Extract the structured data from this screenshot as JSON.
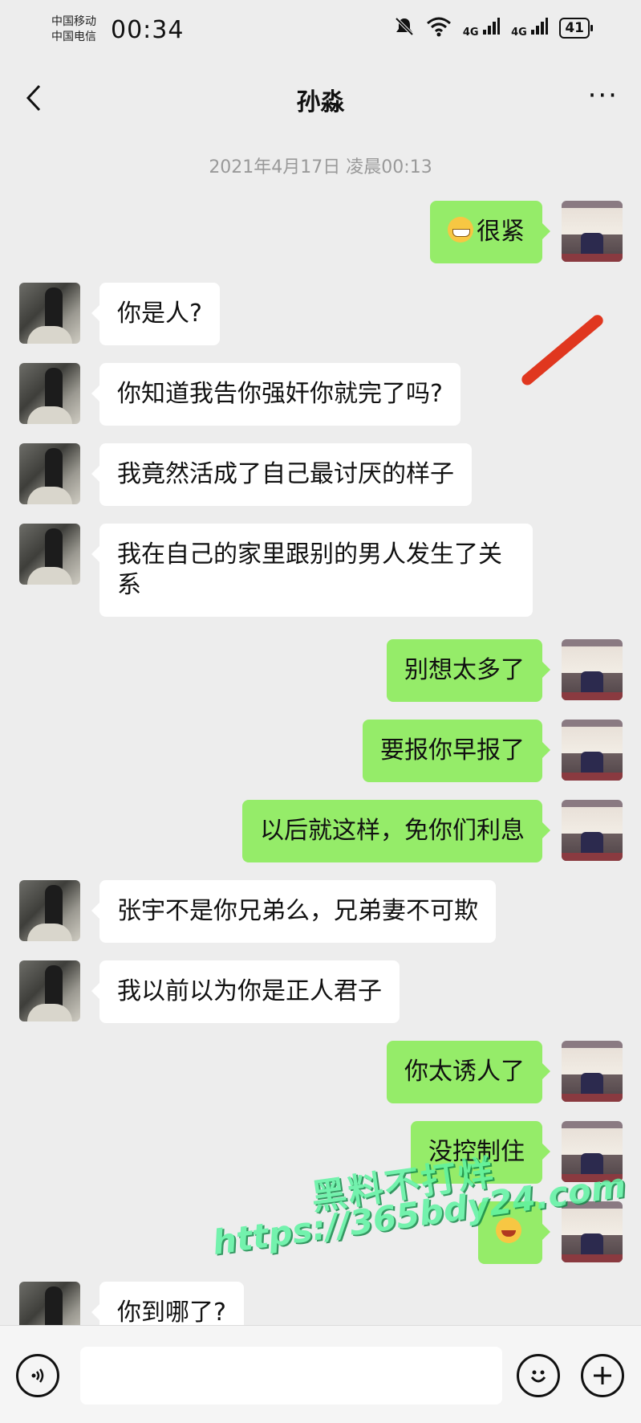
{
  "status_bar": {
    "carrier_1": "中国移动",
    "carrier_2": "中国电信",
    "time": "00:34",
    "network_1": "4G",
    "network_2": "4G",
    "battery": "41",
    "icons": [
      "mute-icon",
      "wifi-icon",
      "signal-icon",
      "signal-icon",
      "battery-icon"
    ]
  },
  "nav": {
    "title": "孙淼",
    "more": "···"
  },
  "chat": {
    "timestamp": "2021年4月17日 凌晨00:13",
    "messages": [
      {
        "from": "me",
        "text": "很紧",
        "emoji": "grin-emoji"
      },
      {
        "from": "other",
        "text": "你是人?"
      },
      {
        "from": "other",
        "text": "你知道我告你强奸你就完了吗?"
      },
      {
        "from": "other",
        "text": "我竟然活成了自己最讨厌的样子"
      },
      {
        "from": "other",
        "text": "我在自己的家里跟别的男人发生了关系"
      },
      {
        "from": "me",
        "text": "别想太多了"
      },
      {
        "from": "me",
        "text": "要报你早报了"
      },
      {
        "from": "me",
        "text": "以后就这样，免你们利息"
      },
      {
        "from": "other",
        "text": "张宇不是你兄弟么，兄弟妻不可欺"
      },
      {
        "from": "other",
        "text": "我以前以为你是正人君子"
      },
      {
        "from": "me",
        "text": "你太诱人了"
      },
      {
        "from": "me",
        "text": "没控制住"
      },
      {
        "from": "me",
        "text": "",
        "emoji": "laughing-tears-emoji"
      },
      {
        "from": "other",
        "text": "你到哪了?"
      }
    ]
  },
  "watermark": {
    "title": "黑料不打烊",
    "url": "https://365bdy24.com"
  },
  "input_bar": {
    "voice_icon": "voice-icon",
    "emoji_icon": "emoji-icon",
    "plus_icon": "plus-icon",
    "input_value": ""
  },
  "colors": {
    "background": "#ededed",
    "outgoing_bubble": "#95ec69",
    "incoming_bubble": "#ffffff",
    "annotation": "#e0371f",
    "watermark": "#5ef3a2"
  }
}
